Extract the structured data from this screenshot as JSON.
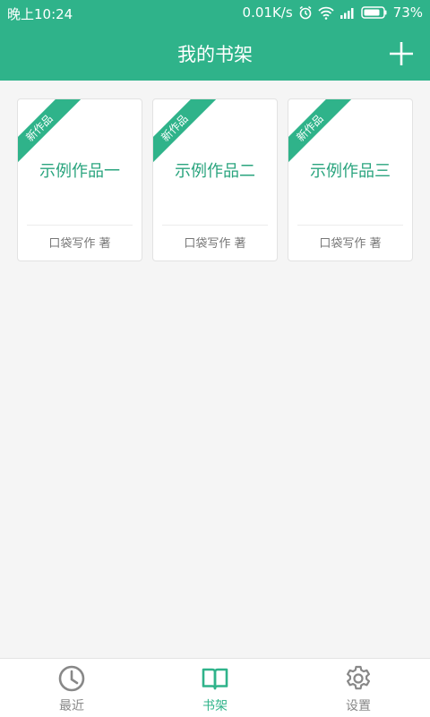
{
  "status_bar": {
    "time": "晚上10:24",
    "network_speed": "0.01K/s",
    "battery_percent": "73%"
  },
  "app_bar": {
    "title": "我的书架",
    "add_icon": "plus-icon"
  },
  "books": [
    {
      "ribbon": "新作品",
      "title": "示例作品一",
      "author": "口袋写作 著"
    },
    {
      "ribbon": "新作品",
      "title": "示例作品二",
      "author": "口袋写作 著"
    },
    {
      "ribbon": "新作品",
      "title": "示例作品三",
      "author": "口袋写作 著"
    }
  ],
  "bottom_nav": {
    "items": [
      {
        "label": "最近",
        "icon": "clock-icon",
        "active": false
      },
      {
        "label": "书架",
        "icon": "book-icon",
        "active": true
      },
      {
        "label": "设置",
        "icon": "gear-icon",
        "active": false
      }
    ]
  },
  "colors": {
    "primary": "#2fb38a",
    "inactive": "#888888"
  }
}
